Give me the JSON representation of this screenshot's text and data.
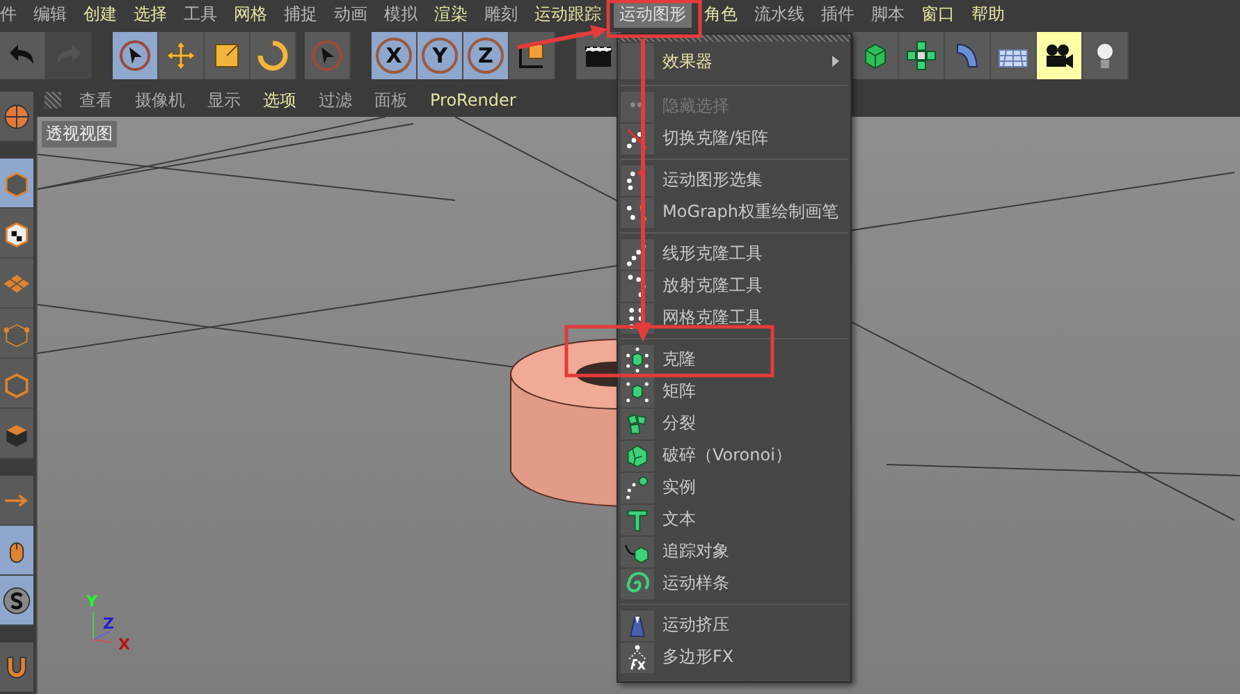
{
  "menubar": {
    "items": [
      {
        "label": "件",
        "accent": false,
        "selected": false
      },
      {
        "label": "编辑",
        "accent": false,
        "selected": false
      },
      {
        "label": "创建",
        "accent": true,
        "selected": false
      },
      {
        "label": "选择",
        "accent": true,
        "selected": false
      },
      {
        "label": "工具",
        "accent": false,
        "selected": false
      },
      {
        "label": "网格",
        "accent": true,
        "selected": false
      },
      {
        "label": "捕捉",
        "accent": false,
        "selected": false
      },
      {
        "label": "动画",
        "accent": false,
        "selected": false
      },
      {
        "label": "模拟",
        "accent": false,
        "selected": false
      },
      {
        "label": "渲染",
        "accent": true,
        "selected": false
      },
      {
        "label": "雕刻",
        "accent": false,
        "selected": false
      },
      {
        "label": "运动跟踪",
        "accent": true,
        "selected": false
      },
      {
        "label": "运动图形",
        "accent": false,
        "selected": true
      },
      {
        "label": "角色",
        "accent": true,
        "selected": false
      },
      {
        "label": "流水线",
        "accent": false,
        "selected": false
      },
      {
        "label": "插件",
        "accent": false,
        "selected": false
      },
      {
        "label": "脚本",
        "accent": false,
        "selected": false
      },
      {
        "label": "窗口",
        "accent": true,
        "selected": false
      },
      {
        "label": "帮助",
        "accent": true,
        "selected": false
      }
    ]
  },
  "toolbar": {
    "buttons": [
      {
        "selected": false,
        "disabled": false
      },
      {
        "selected": false,
        "disabled": true
      },
      {
        "selected": true,
        "disabled": false
      },
      {
        "selected": false,
        "disabled": false
      },
      {
        "selected": false,
        "disabled": false
      },
      {
        "selected": false,
        "disabled": false
      },
      {
        "selected": false,
        "disabled": false
      },
      {
        "label": "X",
        "selected": true,
        "disabled": false
      },
      {
        "label": "Y",
        "selected": true,
        "disabled": false
      },
      {
        "label": "Z",
        "selected": true,
        "disabled": false
      },
      {
        "selected": false,
        "disabled": false
      },
      {
        "selected": false,
        "disabled": false
      },
      {
        "selected": false,
        "disabled": false
      },
      {
        "selected": false,
        "disabled": false
      },
      {
        "selected": false,
        "disabled": false
      },
      {
        "selected": false,
        "disabled": false
      },
      {
        "selected": true,
        "disabled": false
      },
      {
        "selected": false,
        "disabled": false
      }
    ]
  },
  "left_toolbar": {
    "buttons": [
      {
        "selected": false
      },
      {
        "selected": true
      },
      {
        "selected": false
      },
      {
        "selected": false
      },
      {
        "selected": false
      },
      {
        "selected": false
      },
      {
        "selected": false
      },
      {
        "selected": false
      },
      {
        "selected": true
      },
      {
        "selected": true
      },
      {
        "selected": false
      }
    ]
  },
  "viewport": {
    "menu": [
      {
        "label": "查看",
        "accent": false
      },
      {
        "label": "摄像机",
        "accent": false
      },
      {
        "label": "显示",
        "accent": false
      },
      {
        "label": "选项",
        "accent": true
      },
      {
        "label": "过滤",
        "accent": false
      },
      {
        "label": "面板",
        "accent": false
      },
      {
        "label": "ProRender",
        "accent": true
      }
    ],
    "title": "透视视图",
    "axes": [
      "Y",
      "Z",
      "X"
    ]
  },
  "dropdown": {
    "sections": [
      {
        "items": [
          {
            "label": "效果器",
            "accent": true,
            "submenu": true,
            "disabled": false
          }
        ]
      },
      {
        "items": [
          {
            "label": "隐藏选择",
            "accent": false,
            "submenu": false,
            "disabled": true
          },
          {
            "label": "切换克隆/矩阵",
            "accent": false,
            "submenu": false,
            "disabled": false
          }
        ]
      },
      {
        "items": [
          {
            "label": "运动图形选集",
            "accent": false,
            "submenu": false,
            "disabled": false
          },
          {
            "label": "MoGraph权重绘制画笔",
            "accent": false,
            "submenu": false,
            "disabled": false
          }
        ]
      },
      {
        "items": [
          {
            "label": "线形克隆工具",
            "accent": false,
            "submenu": false,
            "disabled": false
          },
          {
            "label": "放射克隆工具",
            "accent": false,
            "submenu": false,
            "disabled": false
          },
          {
            "label": "网格克隆工具",
            "accent": false,
            "submenu": false,
            "disabled": false
          }
        ]
      },
      {
        "items": [
          {
            "label": "克隆",
            "accent": false,
            "submenu": false,
            "disabled": false
          },
          {
            "label": "矩阵",
            "accent": false,
            "submenu": false,
            "disabled": false
          },
          {
            "label": "分裂",
            "accent": false,
            "submenu": false,
            "disabled": false
          },
          {
            "label": "破碎（Voronoi）",
            "accent": false,
            "submenu": false,
            "disabled": false
          },
          {
            "label": "实例",
            "accent": false,
            "submenu": false,
            "disabled": false
          },
          {
            "label": "文本",
            "accent": false,
            "submenu": false,
            "disabled": false
          },
          {
            "label": "追踪对象",
            "accent": false,
            "submenu": false,
            "disabled": false
          },
          {
            "label": "运动样条",
            "accent": false,
            "submenu": false,
            "disabled": false
          }
        ]
      },
      {
        "items": [
          {
            "label": "运动挤压",
            "accent": false,
            "submenu": false,
            "disabled": false
          },
          {
            "label": "多边形FX",
            "accent": false,
            "submenu": false,
            "disabled": false
          }
        ]
      }
    ]
  }
}
